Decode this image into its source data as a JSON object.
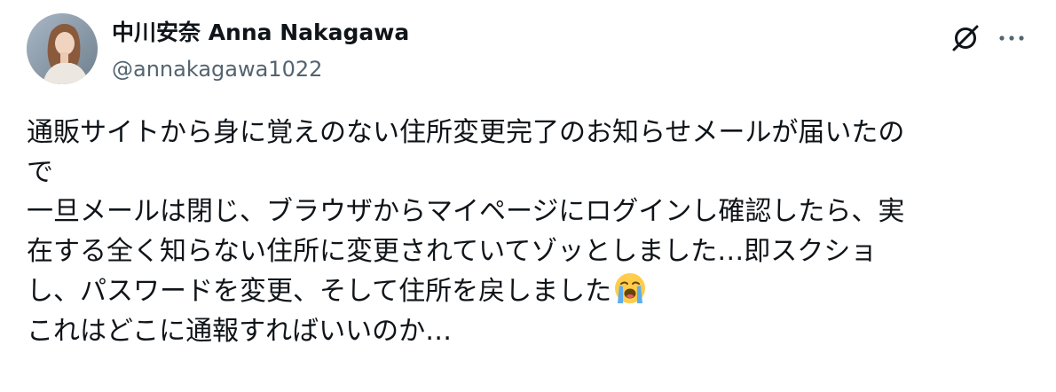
{
  "post": {
    "author": {
      "display_name": "中川安奈 Anna Nakagawa",
      "handle": "@annakagawa1022",
      "avatar_icon": "profile-photo"
    },
    "actions": {
      "grok_icon": "grok-icon",
      "more_icon": "more-icon"
    },
    "body_lines": [
      "通販サイトから身に覚えのない住所変更完了のお知らせメールが届いたの",
      "で",
      "一旦メールは閉じ、ブラウザからマイページにログインし確認したら、実",
      "在する全く知らない住所に変更されていてゾッとしました…即スクショ",
      "し、パスワードを変更、そして住所を戻しました",
      "これはどこに通報すればいいのか…"
    ],
    "emoji_name": "loudly-crying-face",
    "colors": {
      "text": "#0f1419",
      "secondary": "#536471",
      "background": "#ffffff"
    }
  }
}
